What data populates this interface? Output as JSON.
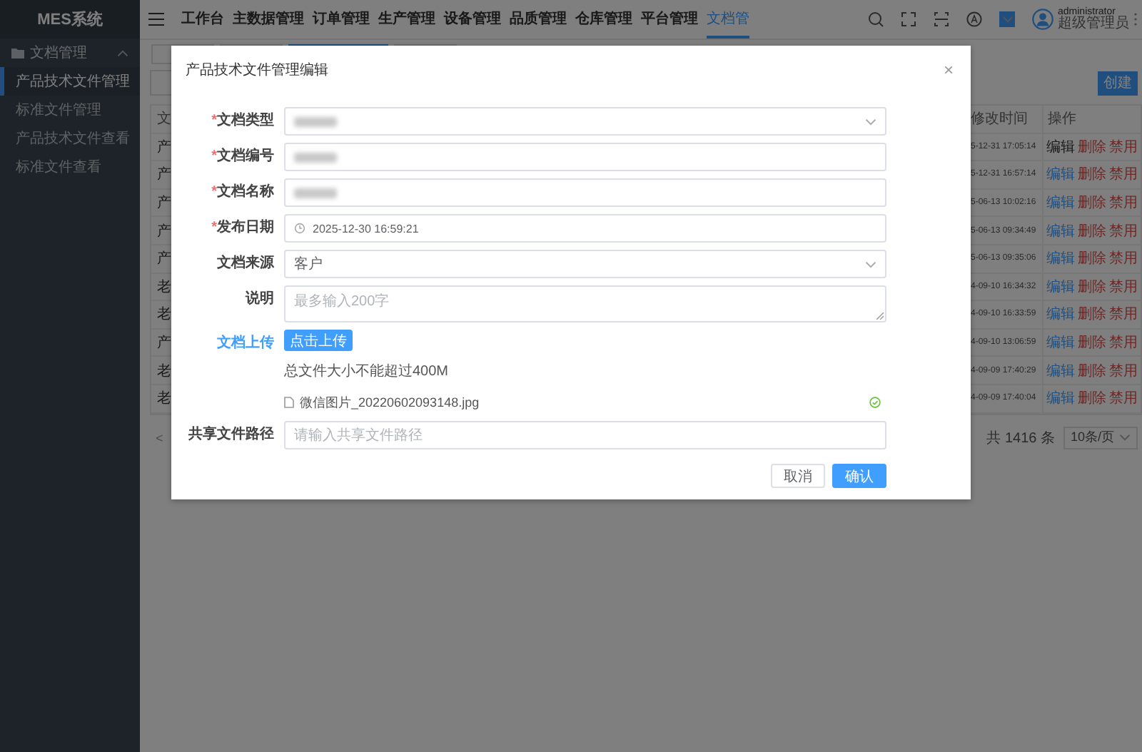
{
  "sidebar": {
    "title": "MES系统",
    "groups": [
      {
        "label": "文档管理",
        "expanded": true,
        "items": [
          {
            "label": "产品技术文件管理",
            "selected": true
          },
          {
            "label": "标准文件管理",
            "selected": false
          },
          {
            "label": "产品技术文件查看",
            "selected": false
          },
          {
            "label": "标准文件查看",
            "selected": false
          }
        ]
      }
    ]
  },
  "header": {
    "nav": [
      {
        "label": "工作台",
        "selected": false
      },
      {
        "label": "主数据管理",
        "selected": false
      },
      {
        "label": "订单管理",
        "selected": false
      },
      {
        "label": "生产管理",
        "selected": false
      },
      {
        "label": "设备管理",
        "selected": false
      },
      {
        "label": "品质管理",
        "selected": false
      },
      {
        "label": "仓库管理",
        "selected": false
      },
      {
        "label": "平台管理",
        "selected": false
      },
      {
        "label": "文档管",
        "selected": true
      }
    ],
    "user": {
      "name": "administrator",
      "role": "超级管理员"
    }
  },
  "tabs": [
    {
      "selected": false
    },
    {
      "selected": false
    },
    {
      "selected": true
    },
    {
      "selected": false
    }
  ],
  "page": {
    "create_button": "创建",
    "table": {
      "columns": [
        "文",
        "修改时间",
        "操作"
      ],
      "rows": [
        {
          "column_1": "产",
          "modified": "5-12-31 17:05:14",
          "actions": [
            "编辑",
            "删除",
            "禁用"
          ],
          "hovered": true
        },
        {
          "column_1": "产",
          "modified": "5-12-31 16:57:14",
          "actions": [
            "编辑",
            "删除",
            "禁用"
          ],
          "hovered": false
        },
        {
          "column_1": "产",
          "modified": "5-06-13 10:02:16",
          "actions": [
            "编辑",
            "删除",
            "禁用"
          ],
          "hovered": false
        },
        {
          "column_1": "产",
          "modified": "5-06-13 09:34:49",
          "actions": [
            "编辑",
            "删除",
            "禁用"
          ],
          "hovered": false
        },
        {
          "column_1": "产",
          "modified": "5-06-13 09:35:06",
          "actions": [
            "编辑",
            "删除",
            "禁用"
          ],
          "hovered": false
        },
        {
          "column_1": "老",
          "modified": "4-09-10 16:34:32",
          "actions": [
            "编辑",
            "删除",
            "禁用"
          ],
          "hovered": false
        },
        {
          "column_1": "老",
          "modified": "4-09-10 16:33:59",
          "actions": [
            "编辑",
            "删除",
            "禁用"
          ],
          "hovered": false
        },
        {
          "column_1": "产",
          "modified": "4-09-10 13:06:59",
          "actions": [
            "编辑",
            "删除",
            "禁用"
          ],
          "hovered": false
        },
        {
          "column_1": "老",
          "modified": "4-09-09 17:40:29",
          "actions": [
            "编辑",
            "删除",
            "禁用"
          ],
          "hovered": false
        },
        {
          "column_1": "老",
          "modified": "4-09-09 17:40:04",
          "actions": [
            "编辑",
            "删除",
            "禁用"
          ],
          "hovered": false
        }
      ]
    },
    "pagination": {
      "prev": "<",
      "total": "共 1416 条",
      "page_size": "10条/页"
    }
  },
  "dialog": {
    "title": "产品技术文件管理编辑",
    "close": "×",
    "required_mark": "*",
    "fields": [
      {
        "kind": "select",
        "label": "文档类型",
        "required": true,
        "blurred": true
      },
      {
        "kind": "input",
        "label": "文档编号",
        "required": true,
        "blurred": true
      },
      {
        "kind": "input",
        "label": "文档名称",
        "required": true,
        "blurred": true
      },
      {
        "kind": "date",
        "label": "发布日期",
        "required": true,
        "value": "2025-12-30 16:59:21"
      },
      {
        "kind": "select",
        "label": "文档来源",
        "required": false,
        "value": "客户"
      },
      {
        "kind": "textarea",
        "label": "说明",
        "required": false,
        "placeholder": "最多输入200字"
      },
      {
        "kind": "upload",
        "label": "文档上传",
        "required": false,
        "button": "点击上传",
        "hint": "总文件大小不能超过400M",
        "files": [
          {
            "name": "微信图片_20220602093148.jpg",
            "uploaded": true
          }
        ]
      },
      {
        "kind": "input",
        "label": "共享文件路径",
        "required": false,
        "placeholder": "请输入共享文件路径"
      }
    ],
    "buttons": [
      {
        "label": "取消",
        "primary": false
      },
      {
        "label": "确认",
        "primary": true
      }
    ]
  }
}
